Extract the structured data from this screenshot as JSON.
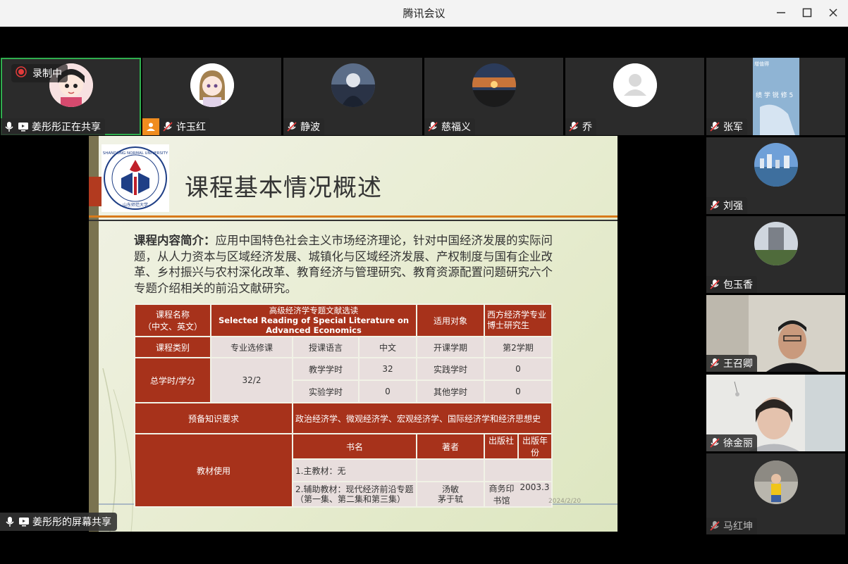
{
  "app": {
    "title": "腾讯会议"
  },
  "recording": {
    "label": "录制中"
  },
  "participants": [
    {
      "name": "姜彤彤正在共享"
    },
    {
      "name": "许玉红"
    },
    {
      "name": "静波"
    },
    {
      "name": "慈福义"
    },
    {
      "name": "乔"
    },
    {
      "name": "张军"
    },
    {
      "name": "刘强"
    },
    {
      "name": "包玉香"
    },
    {
      "name": "王召卿"
    },
    {
      "name": "徐金丽"
    },
    {
      "name": "马红坤"
    }
  ],
  "thumb": {
    "text1": "增值得",
    "text2": "绩 学 锐 修 5"
  },
  "share_label": "姜彤彤的屏幕共享",
  "slide": {
    "title": "课程基本情况概述",
    "logo_text": "SHANDONG NORMAL UNIVERSITY",
    "logo_cn": "山东师范大学",
    "intro_label": "课程内容简介：",
    "intro_text": "应用中国特色社会主义市场经济理论，针对中国经济发展的实际问题，从人力资本与区域经济发展、城镇化与区域经济发展、产权制度与国有企业改革、乡村振兴与农村深化改革、教育经济与管理研究、教育资源配置问题研究六个专题介绍相关的前沿文献研究。",
    "date": "2024/2/20",
    "table": {
      "name_label_1": "课程名称",
      "name_label_2": "（中文、英文）",
      "course_cn": "高级经济学专题文献选读",
      "course_en_1": "Selected Reading of Special Literature on",
      "course_en_2": "Advanced Economics",
      "target_label": "适用对象",
      "target_1": "西方经济学专业",
      "target_2": "博士研究生",
      "type_label": "课程类别",
      "type_value": "专业选修课",
      "lang_label": "授课语言",
      "lang_value": "中文",
      "term_label": "开课学期",
      "term_value": "第2学期",
      "hours_label": "总学时/学分",
      "hours_value": "32/2",
      "teach_label": "教学学时",
      "teach_value": "32",
      "practice_label": "实践学时",
      "practice_value": "0",
      "lab_label": "实验学时",
      "lab_value": "0",
      "other_label": "其他学时",
      "other_value": "0",
      "prereq_label": "预备知识要求",
      "prereq_value": "政治经济学、微观经济学、宏观经济学、国际经济学和经济思想史",
      "textbook_label": "教材使用",
      "col_book": "书名",
      "col_author": "著者",
      "col_publisher": "出版社",
      "col_year": "出版年份",
      "book1": "1.主教材：无",
      "book2_1": "2.辅助教材：现代经济前沿专题",
      "book2_2": "（第一集、第二集和第三集）",
      "author2_1": "汤敏",
      "author2_2": "茅于轼",
      "publisher2": "商务印书馆",
      "year2": "2003.3"
    }
  },
  "colors": {
    "accent_green": "#2fae4e",
    "table_red": "#a7321b",
    "table_light": "#e8dedd",
    "rule_orange": "#d87a1a"
  }
}
